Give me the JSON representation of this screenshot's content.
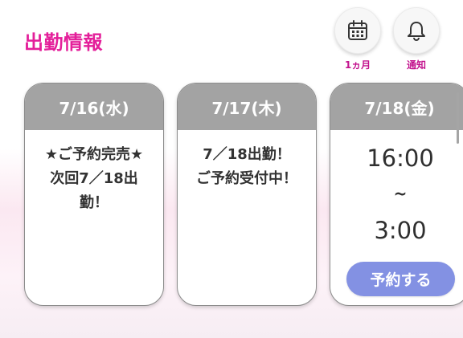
{
  "header": {
    "title": "出勤情報"
  },
  "actions": {
    "calendar": {
      "label": "1ヵ月",
      "icon": "calendar-icon"
    },
    "notification": {
      "label": "通知",
      "icon": "bell-icon"
    }
  },
  "schedule": [
    {
      "date": "7/16(水)",
      "note": "★ご予約完売★\n次回7／18出\n勤！"
    },
    {
      "date": "7/17(木)",
      "note": "7／18出勤！\nご予約受付中！"
    },
    {
      "date": "7/18(金)",
      "start": "16:00",
      "separator": "~",
      "end": "3:00",
      "button_label": "予約する"
    }
  ],
  "colors": {
    "accent": "#e41f9a",
    "card_header": "#a3a3a3",
    "reserve_button": "#8391e3"
  }
}
